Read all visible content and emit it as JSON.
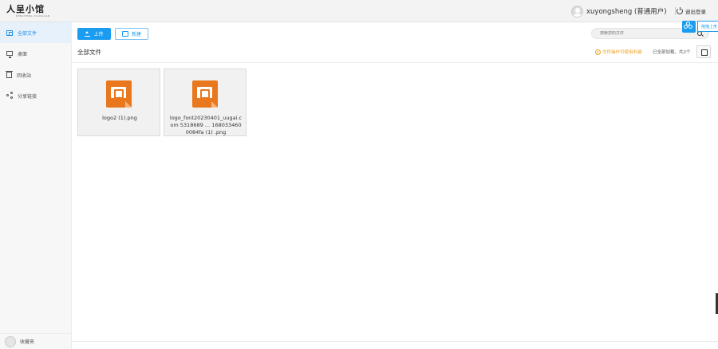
{
  "header": {
    "logo_text": "人呈小馆",
    "logo_sub": "RENCHENG XIAOGUAN",
    "username": "xuyongsheng (普通用户)",
    "logout_label": "退出登录"
  },
  "sidebar": {
    "items": [
      {
        "label": "全部文件",
        "icon": "folder-icon",
        "active": true
      },
      {
        "label": "桌面",
        "icon": "desktop-icon",
        "active": false
      },
      {
        "label": "回收站",
        "icon": "trash-icon",
        "active": false
      },
      {
        "label": "分享链接",
        "icon": "share-icon",
        "active": false
      }
    ],
    "vip_label": "收藏夹"
  },
  "toolbar": {
    "upload_label": "上传",
    "new_label": "新建",
    "search_placeholder": "搜索您的文件"
  },
  "float_tool": {
    "label": "拖拽上传"
  },
  "subbar": {
    "breadcrumb": "全部文件",
    "notice": "文件操作可使用右键",
    "loaded": "已全部加载，共2个"
  },
  "files": [
    {
      "name": "logo2 (1).png"
    },
    {
      "name": "logo_font20230401_uugai.com 5318689 … 1680334600084fa (1) .png"
    }
  ],
  "colors": {
    "accent": "#1a9cf0",
    "file_icon": "#e8771e",
    "notice": "#f0a020"
  }
}
